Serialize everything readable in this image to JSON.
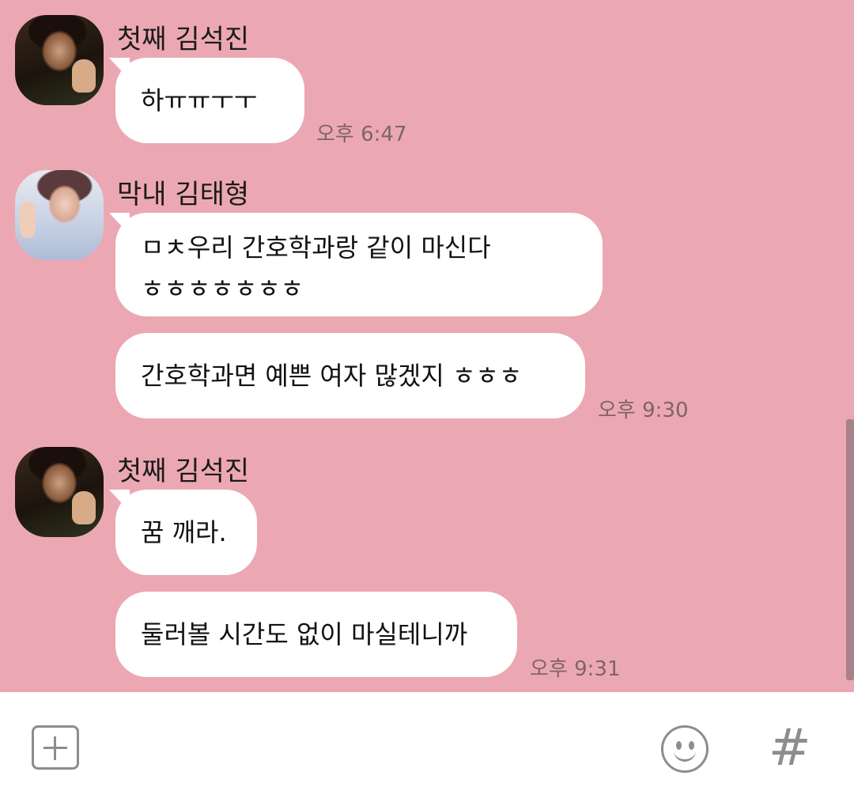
{
  "messages": [
    {
      "sender": "첫째 김석진",
      "avatar": "jin-profile-photo",
      "bubbles": [
        "하ㅠㅠㅜㅜ"
      ],
      "time": "오후 6:47"
    },
    {
      "sender": "막내 김태형",
      "avatar": "v-profile-photo",
      "bubbles": [
        [
          "ㅁㅊ우리 간호학과랑 같이 마신다",
          "ㅎㅎㅎㅎㅎㅎㅎ"
        ],
        "간호학과면 예쁜 여자 많겠지 ㅎㅎㅎ"
      ],
      "time": "오후 9:30"
    },
    {
      "sender": "첫째 김석진",
      "avatar": "jin-profile-photo",
      "bubbles": [
        "꿈 깨라.",
        "둘러볼 시간도 없이 마실테니까"
      ],
      "time": "오후 9:31"
    }
  ],
  "input_bar": {
    "plus_icon": "plus-square-icon",
    "emoji_icon": "smiley-icon",
    "hash_label": "#"
  },
  "colors": {
    "chat_background": "#eca8b2",
    "bubble": "#ffffff",
    "timestamp": "#7d6468",
    "icon_gray": "#8d8d8d"
  }
}
